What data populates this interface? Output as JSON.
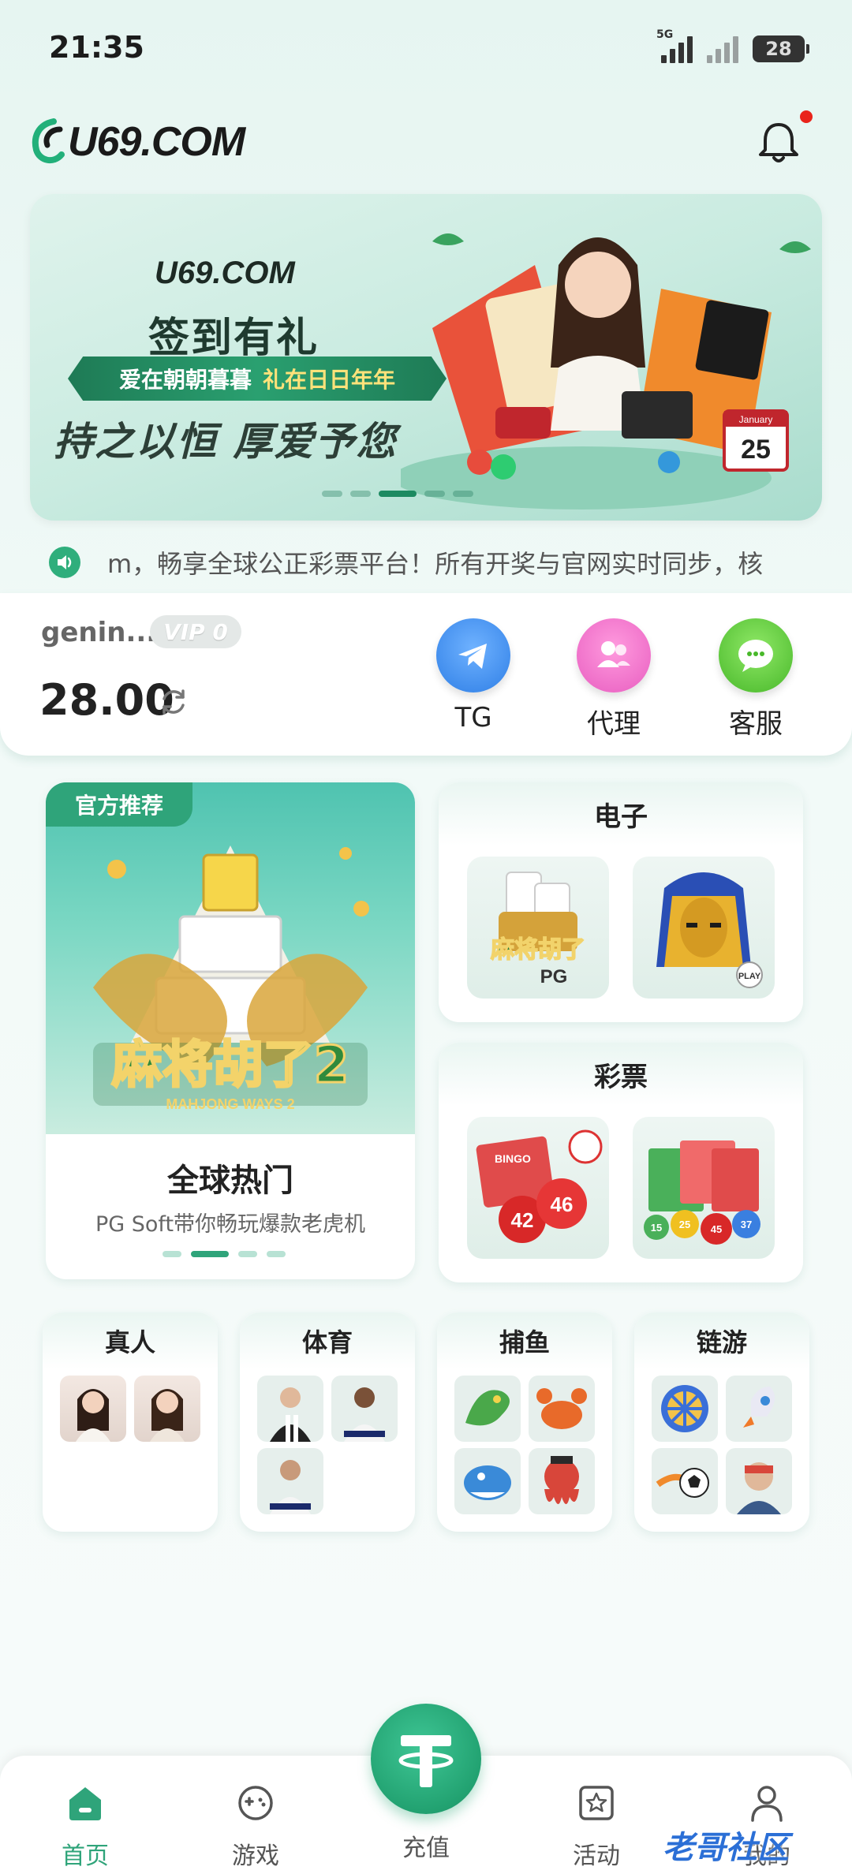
{
  "status_bar": {
    "time": "21:35",
    "network": "5G",
    "battery": "28"
  },
  "header": {
    "logo": "U69.COM"
  },
  "banner": {
    "logo": "U69.COM",
    "title": "签到有礼",
    "ribbon_left": "爱在朝朝暮暮",
    "ribbon_right": "礼在日日年年",
    "subtitle": "持之以恒 厚爱予您",
    "calendar_month": "January",
    "calendar_day": "25",
    "slides": 5,
    "active_slide": 3
  },
  "marquee": {
    "text": "m，畅享全球公正彩票平台！所有开奖与官网实时同步，核"
  },
  "user": {
    "name": "genin...",
    "vip": "VIP 0",
    "balance": "28.00"
  },
  "quick_actions": [
    {
      "label": "TG",
      "color": "#3a8ef0"
    },
    {
      "label": "代理",
      "color": "#f06fc4"
    },
    {
      "label": "客服",
      "color": "#5bcc3a"
    }
  ],
  "featured": {
    "badge": "官方推荐",
    "title": "全球热门",
    "subtitle": "PG Soft带你畅玩爆款老虎机",
    "art_text": "麻将胡了2",
    "art_sub": "MAHJONG WAYS 2"
  },
  "sections": {
    "electronic": {
      "title": "电子",
      "tile1": "麻将胡了",
      "tile1_sub": "PG",
      "tile2_badge": "PLAY"
    },
    "lottery": {
      "title": "彩票",
      "tile1_text": "BINGO",
      "ball1": "42",
      "ball2": "46",
      "balls": [
        "15",
        "25",
        "45",
        "37"
      ]
    },
    "live": {
      "title": "真人"
    },
    "sports": {
      "title": "体育"
    },
    "fishing": {
      "title": "捕鱼"
    },
    "chain": {
      "title": "链游"
    }
  },
  "bottom_nav": {
    "home": "首页",
    "games": "游戏",
    "deposit": "充值",
    "activity": "活动",
    "mine": "我的"
  },
  "watermark": "老哥社区",
  "colors": {
    "accent": "#2fa47a",
    "notification": "#e9241b"
  }
}
